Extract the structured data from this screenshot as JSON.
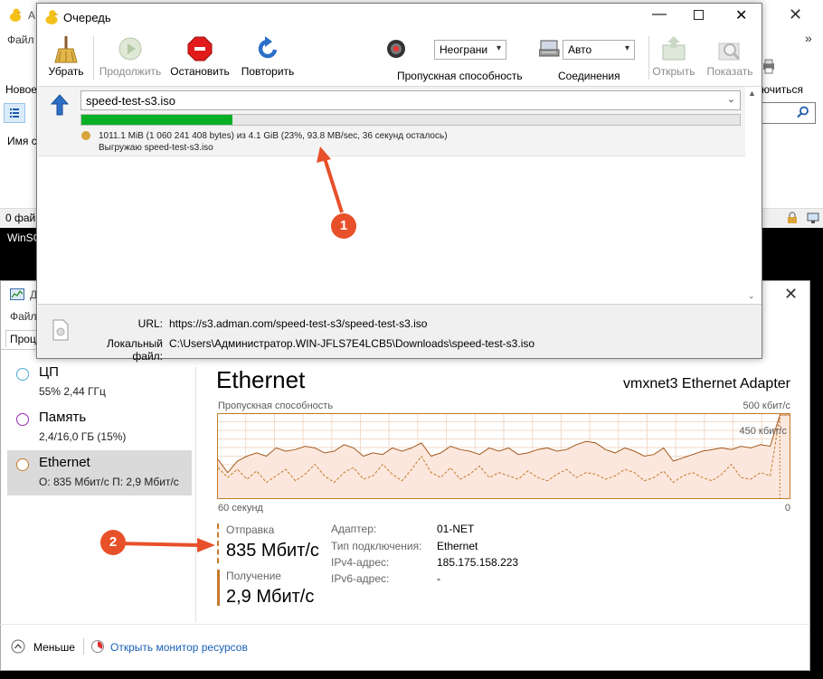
{
  "background_window": {
    "title_partial": "A",
    "menu_partial": "Файл",
    "new_partial": "Новое",
    "column_partial": "Имя с",
    "status_partial": "0 фай",
    "connect_partial": "ючиться",
    "taskbar_partial": "WinSC",
    "chevron": "»"
  },
  "queue_window": {
    "title": "Очередь",
    "toolbar": {
      "remove": "Убрать",
      "resume": "Продолжить",
      "stop": "Остановить",
      "retry": "Повторить",
      "speed_value": "Неограни",
      "speed_label": "Пропускная способность",
      "connections_value": "Авто",
      "connections_label": "Соединения",
      "open": "Открыть",
      "show": "Показать"
    },
    "item": {
      "file": "speed-test-s3.iso",
      "progress_percent": 23,
      "progress_text": "1011.1 MiB (1 060 241 408 bytes) из 4.1 GiB (23%, 93.8 MB/sec, 36 секунд осталось)",
      "action_text": "Выгружаю speed-test-s3.iso"
    },
    "info": {
      "url_label": "URL:",
      "url_value": "https://s3.adman.com/speed-test-s3/speed-test-s3.iso",
      "local_label": "Локальный файл:",
      "local_value": "C:\\Users\\Администратор.WIN-JFLS7E4LCB5\\Downloads\\speed-test-s3.iso"
    }
  },
  "task_manager": {
    "title_partial": "Д",
    "menu_partial": "Файл",
    "tab_partial": "Проц",
    "sidebar": [
      {
        "name": "ЦП",
        "sub": "55% 2,44 ГГц",
        "color": "#4da6d9"
      },
      {
        "name": "Память",
        "sub": "2,4/16,0 ГБ (15%)",
        "color": "#9c2ab5"
      },
      {
        "name": "Ethernet",
        "sub": "О: 835 Мбит/с П: 2,9 Мбит/с",
        "color": "#c47a2c"
      }
    ],
    "perf": {
      "title": "Ethernet",
      "adapter": "vmxnet3 Ethernet Adapter",
      "graph_label": "Пропускная способность",
      "graph_max": "500 кбит/с",
      "graph_line": "450 кбит/с",
      "graph_time": "60 секунд",
      "graph_zero": "0",
      "send_label": "Отправка",
      "send_value": "835 Мбит/с",
      "recv_label": "Получение",
      "recv_value": "2,9 Мбит/с",
      "details": [
        {
          "k": "Адаптер:",
          "v": "01-NET"
        },
        {
          "k": "Тип подключения:",
          "v": "Ethernet"
        },
        {
          "k": "IPv4-адрес:",
          "v": "185.175.158.223"
        },
        {
          "k": "IPv6-адрес:",
          "v": "-"
        }
      ]
    },
    "footer": {
      "less": "Меньше",
      "open_monitor": "Открыть монитор ресурсов"
    }
  },
  "chart_data": {
    "type": "line",
    "title": "Пропускная способность",
    "ylim": [
      0,
      500
    ],
    "y_max_label": "500 кбит/с",
    "ref_line_label": "450 кбит/с",
    "x_left_label": "60 секунд",
    "x_right_label": "0",
    "grid": true,
    "series": [
      {
        "values": [
          230,
          150,
          220,
          250,
          270,
          250,
          300,
          280,
          290,
          310,
          300,
          270,
          280,
          320,
          300,
          250,
          270,
          260,
          300,
          280,
          300,
          330,
          250,
          270,
          310,
          290,
          280,
          260,
          300,
          280,
          300,
          260,
          270,
          290,
          300,
          280,
          290,
          320,
          340,
          330,
          290,
          270,
          300,
          280,
          250,
          260,
          300,
          220,
          240,
          260,
          280,
          290,
          300,
          290,
          310,
          300,
          320,
          310,
          500,
          500
        ]
      },
      {
        "values": [
          180,
          120,
          170,
          110,
          160,
          90,
          130,
          170,
          100,
          140,
          200,
          130,
          90,
          150,
          180,
          110,
          130,
          200,
          140,
          100,
          170,
          250,
          150,
          120,
          180,
          110,
          140,
          190,
          120,
          150,
          130,
          110,
          160,
          120,
          100,
          140,
          170,
          120,
          150,
          140,
          110,
          130,
          170,
          150,
          100,
          120,
          160,
          90,
          130,
          150,
          120,
          100,
          140,
          200,
          120,
          110,
          150,
          130,
          500,
          500
        ]
      }
    ]
  }
}
